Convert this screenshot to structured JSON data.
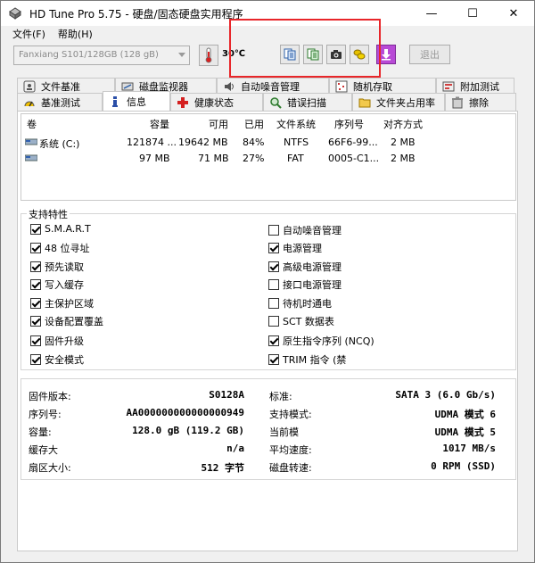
{
  "window": {
    "title": "HD Tune Pro 5.75 - 硬盘/固态硬盘实用程序",
    "minimize": "—",
    "maximize": "☐",
    "close": "✕"
  },
  "menu": [
    {
      "label": "文件(F)"
    },
    {
      "label": "帮助(H)"
    }
  ],
  "toolbar": {
    "drive": "Fanxiang S101/128GB (128 gB)",
    "temperature": "30℃",
    "exit_label": "退出",
    "buttons": [
      "copy-text-icon",
      "copy-screenshot-icon",
      "camera-icon",
      "coins-icon",
      "download-icon"
    ]
  },
  "tabs_row1": [
    {
      "label": "文件基准",
      "icon": "file-benchmark-icon"
    },
    {
      "label": "磁盘监视器",
      "icon": "disk-monitor-icon"
    },
    {
      "label": "自动噪音管理",
      "icon": "speaker-icon"
    },
    {
      "label": "随机存取",
      "icon": "random-access-icon"
    },
    {
      "label": "附加测试",
      "icon": "extra-tests-icon"
    }
  ],
  "tabs_row2": [
    {
      "label": "基准测试",
      "icon": "benchmark-icon"
    },
    {
      "label": "信息",
      "icon": "info-icon"
    },
    {
      "label": "健康状态",
      "icon": "health-icon"
    },
    {
      "label": "错误扫描",
      "icon": "error-scan-icon"
    },
    {
      "label": "文件夹占用率",
      "icon": "folder-icon"
    },
    {
      "label": "擦除",
      "icon": "erase-icon"
    }
  ],
  "volumes": {
    "headers": [
      "卷",
      "容量",
      "可用",
      "已用",
      "文件系统",
      "序列号",
      "对齐方式"
    ],
    "rows": [
      {
        "volume": "系统 (C:)",
        "capacity": "121874 ...",
        "free": "19642 MB",
        "used": "84%",
        "fs": "NTFS",
        "serial": "66F6-99...",
        "align": "2 MB"
      },
      {
        "volume": "",
        "capacity": "97 MB",
        "free": "71 MB",
        "used": "27%",
        "fs": "FAT",
        "serial": "0005-C1...",
        "align": "2 MB"
      }
    ]
  },
  "features": {
    "title": "支持特性",
    "left": [
      {
        "label": "S.M.A.R.T",
        "checked": true
      },
      {
        "label": "48 位寻址",
        "checked": true
      },
      {
        "label": "预先读取",
        "checked": true
      },
      {
        "label": "写入缓存",
        "checked": true
      },
      {
        "label": "主保护区域",
        "checked": true
      },
      {
        "label": "设备配置覆盖",
        "checked": true
      },
      {
        "label": "固件升级",
        "checked": true
      },
      {
        "label": "安全模式",
        "checked": true
      }
    ],
    "right": [
      {
        "label": "自动噪音管理",
        "checked": false
      },
      {
        "label": "电源管理",
        "checked": true
      },
      {
        "label": "高级电源管理",
        "checked": true
      },
      {
        "label": "接口电源管理",
        "checked": false
      },
      {
        "label": "待机时通电",
        "checked": false
      },
      {
        "label": "SCT 数据表",
        "checked": false
      },
      {
        "label": "原生指令序列 (NCQ)",
        "checked": true
      },
      {
        "label": "TRIM 指令 (禁",
        "checked": true
      }
    ]
  },
  "info": {
    "left": [
      {
        "label": "固件版本:",
        "value": "S0128A"
      },
      {
        "label": "序列号:",
        "value": "AA000000000000000949"
      },
      {
        "label": "容量:",
        "value": "128.0 gB (119.2 GB)"
      },
      {
        "label": "缓存大",
        "value": "n/a"
      },
      {
        "label": "扇区大小:",
        "value": "512 字节"
      }
    ],
    "right": [
      {
        "label": "标准:",
        "value": "SATA 3 (6.0 Gb/s)"
      },
      {
        "label": "支持模式:",
        "value": "UDMA 模式 6"
      },
      {
        "label": "当前模",
        "value": "UDMA 模式 5"
      },
      {
        "label": "平均速度:",
        "value": "1017 MB/s"
      },
      {
        "label": "磁盘转速:",
        "value": "0 RPM (SSD)"
      }
    ]
  }
}
